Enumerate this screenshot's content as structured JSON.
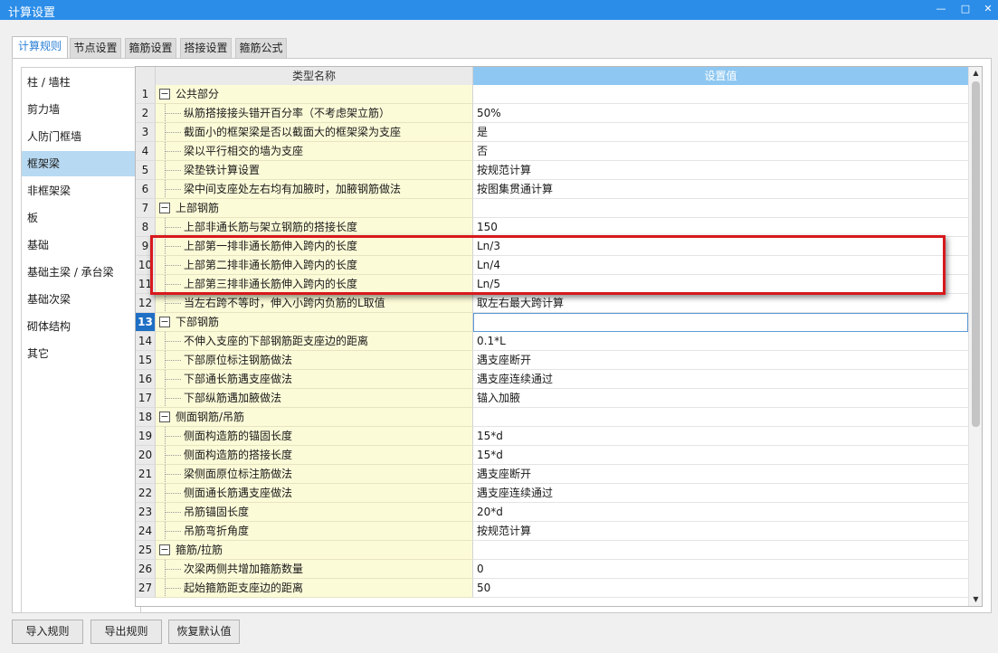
{
  "window": {
    "title": "计算设置",
    "min_icon": "minimize-icon",
    "max_icon": "maximize-icon",
    "close_icon": "close-icon"
  },
  "tabs": [
    {
      "label": "计算规则",
      "active": true
    },
    {
      "label": "节点设置"
    },
    {
      "label": "箍筋设置"
    },
    {
      "label": "搭接设置"
    },
    {
      "label": "箍筋公式"
    }
  ],
  "sidebar": {
    "items": [
      {
        "label": "柱 / 墙柱"
      },
      {
        "label": "剪力墙"
      },
      {
        "label": "人防门框墙"
      },
      {
        "label": "框架梁",
        "selected": true
      },
      {
        "label": "非框架梁"
      },
      {
        "label": "板"
      },
      {
        "label": "基础"
      },
      {
        "label": "基础主梁 / 承台梁"
      },
      {
        "label": "基础次梁"
      },
      {
        "label": "砌体结构"
      },
      {
        "label": "其它"
      }
    ]
  },
  "grid": {
    "headers": {
      "name": "类型名称",
      "value": "设置值"
    },
    "rows": [
      {
        "num": "1",
        "group": true,
        "name": "公共部分",
        "value": ""
      },
      {
        "num": "2",
        "name": "纵筋搭接接头错开百分率（不考虑架立筋）",
        "value": "50%"
      },
      {
        "num": "3",
        "name": "截面小的框架梁是否以截面大的框架梁为支座",
        "value": "是"
      },
      {
        "num": "4",
        "name": "梁以平行相交的墙为支座",
        "value": "否"
      },
      {
        "num": "5",
        "name": "梁垫铁计算设置",
        "value": "按规范计算"
      },
      {
        "num": "6",
        "name": "梁中间支座处左右均有加腋时，加腋钢筋做法",
        "value": "按图集贯通计算"
      },
      {
        "num": "7",
        "group": true,
        "name": "上部钢筋",
        "value": ""
      },
      {
        "num": "8",
        "name": "上部非通长筋与架立钢筋的搭接长度",
        "value": "150"
      },
      {
        "num": "9",
        "name": "上部第一排非通长筋伸入跨内的长度",
        "value": "Ln/3"
      },
      {
        "num": "10",
        "name": "上部第二排非通长筋伸入跨内的长度",
        "value": "Ln/4"
      },
      {
        "num": "11",
        "name": "上部第三排非通长筋伸入跨内的长度",
        "value": "Ln/5"
      },
      {
        "num": "12",
        "name": "当左右跨不等时，伸入小跨内负筋的L取值",
        "value": "取左右最大跨计算"
      },
      {
        "num": "13",
        "group": true,
        "selected": true,
        "name": "下部钢筋",
        "value": ""
      },
      {
        "num": "14",
        "name": "不伸入支座的下部钢筋距支座边的距离",
        "value": "0.1*L"
      },
      {
        "num": "15",
        "name": "下部原位标注钢筋做法",
        "value": "遇支座断开"
      },
      {
        "num": "16",
        "name": "下部通长筋遇支座做法",
        "value": "遇支座连续通过"
      },
      {
        "num": "17",
        "name": "下部纵筋遇加腋做法",
        "value": "锚入加腋"
      },
      {
        "num": "18",
        "group": true,
        "name": "侧面钢筋/吊筋",
        "value": ""
      },
      {
        "num": "19",
        "name": "侧面构造筋的锚固长度",
        "value": "15*d"
      },
      {
        "num": "20",
        "name": "侧面构造筋的搭接长度",
        "value": "15*d"
      },
      {
        "num": "21",
        "name": "梁侧面原位标注筋做法",
        "value": "遇支座断开"
      },
      {
        "num": "22",
        "name": "侧面通长筋遇支座做法",
        "value": "遇支座连续通过"
      },
      {
        "num": "23",
        "name": "吊筋锚固长度",
        "value": "20*d"
      },
      {
        "num": "24",
        "name": "吊筋弯折角度",
        "value": "按规范计算"
      },
      {
        "num": "25",
        "group": true,
        "name": "箍筋/拉筋",
        "value": ""
      },
      {
        "num": "26",
        "name": "次梁两侧共增加箍筋数量",
        "value": "0"
      },
      {
        "num": "27",
        "name": "起始箍筋距支座边的距离",
        "value": "50"
      }
    ]
  },
  "footer": {
    "import_label": "导入规则",
    "export_label": "导出规则",
    "reset_label": "恢复默认值"
  },
  "colors": {
    "titlebar": "#2b8de8",
    "highlight": "#d7191c",
    "header_value": "#8ec8f2",
    "name_cell": "#fcfbd8"
  }
}
